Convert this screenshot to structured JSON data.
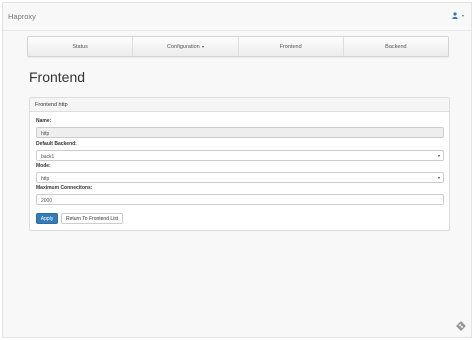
{
  "app": {
    "brand": "Haproxy"
  },
  "user_menu": {
    "icon": "user-icon"
  },
  "nav": {
    "items": [
      {
        "label": "Status"
      },
      {
        "label": "Configuration",
        "dropdown": true
      },
      {
        "label": "Frontend"
      },
      {
        "label": "Backend"
      }
    ]
  },
  "page": {
    "title": "Frontend"
  },
  "panel": {
    "heading": "Frontend http",
    "fields": {
      "name_label": "Name:",
      "name_value": "http",
      "backend_label": "Default Backend:",
      "backend_value": "back1",
      "mode_label": "Mode:",
      "mode_value": "http",
      "maxconn_label": "Maximum Connecitons:",
      "maxconn_value": "2000"
    },
    "buttons": {
      "apply": "Apply",
      "return": "Return To Frontend List"
    }
  },
  "colors": {
    "primary": "#337ab7",
    "navbar_bg": "#f8f8f8"
  }
}
